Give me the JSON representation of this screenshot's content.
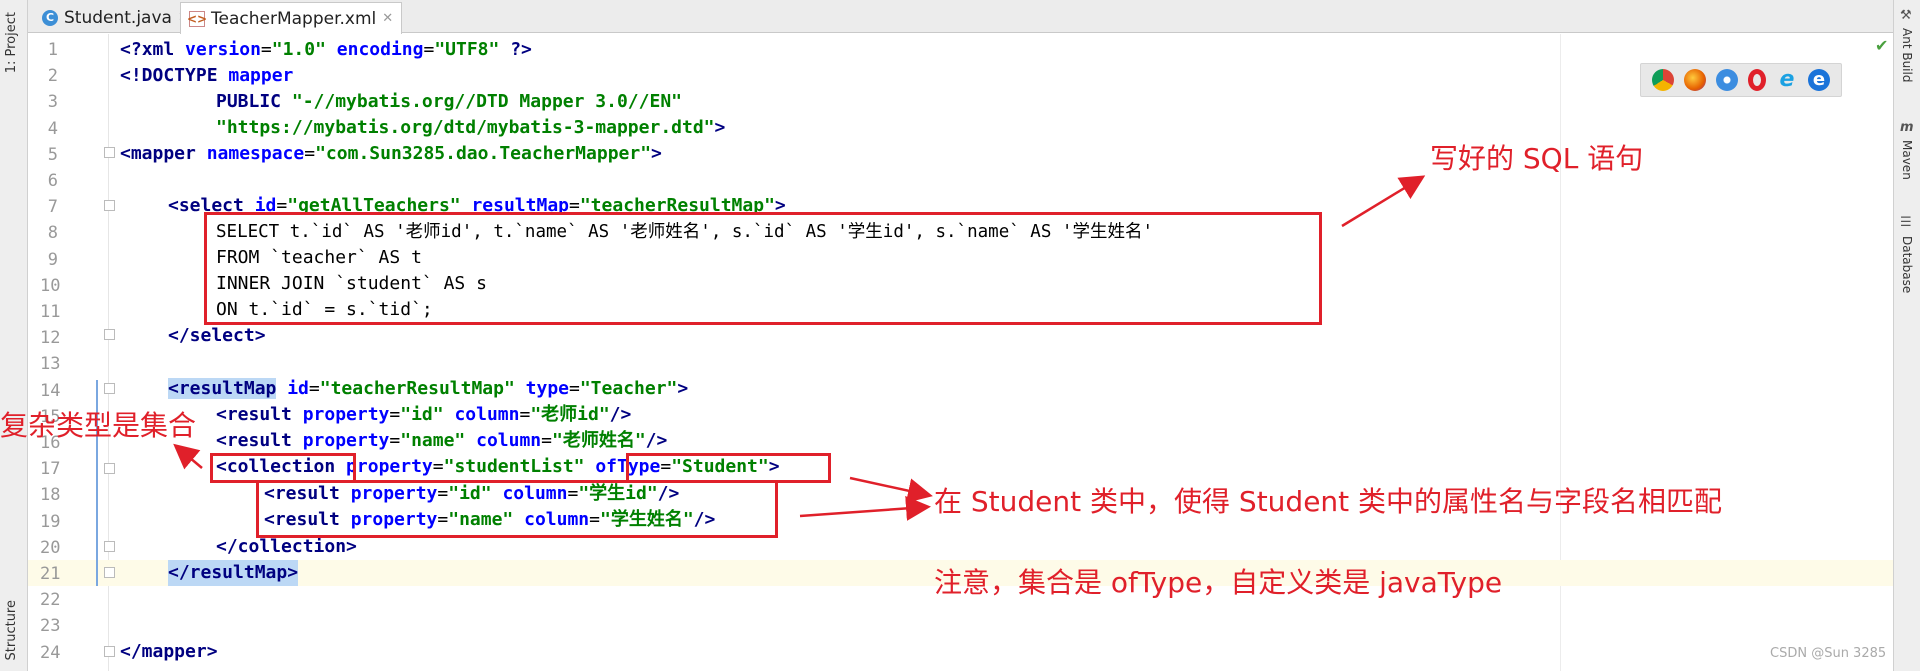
{
  "tabs": [
    {
      "label": "Student.java",
      "icon": "java-class-icon",
      "active": false
    },
    {
      "label": "TeacherMapper.xml",
      "icon": "xml-file-icon",
      "active": true
    }
  ],
  "left_tools": {
    "project": "1: Project",
    "structure": "Structure"
  },
  "right_tools": {
    "ant": "Ant Build",
    "maven": "Maven",
    "database": "Database"
  },
  "line_numbers": [
    "1",
    "2",
    "3",
    "4",
    "5",
    "6",
    "7",
    "8",
    "9",
    "10",
    "11",
    "12",
    "13",
    "14",
    "15",
    "16",
    "17",
    "18",
    "19",
    "20",
    "21",
    "22",
    "23",
    "24"
  ],
  "code": {
    "l1": {
      "a": "<?",
      "b": "xml ",
      "c": "version",
      "d": "=",
      "e": "\"1.0\"",
      "f": " encoding",
      "g": "=",
      "h": "\"UTF8\"",
      "i": " ?>"
    },
    "l2": {
      "a": "<!DOCTYPE ",
      "b": "mapper"
    },
    "l3": {
      "a": "PUBLIC ",
      "b": "\"-//mybatis.org//DTD Mapper 3.0//EN\""
    },
    "l4": {
      "a": "\"https://mybatis.org/dtd/mybatis-3-mapper.dtd\"",
      "b": ">"
    },
    "l5": {
      "a": "<mapper ",
      "b": "namespace",
      "c": "=",
      "d": "\"com.Sun3285.dao.TeacherMapper\"",
      "e": ">"
    },
    "l7": {
      "a": "<select ",
      "b": "id",
      "c": "=",
      "d": "\"getAllTeachers\"",
      "e": " resultMap",
      "f": "=",
      "g": "\"teacherResultMap\"",
      "h": ">"
    },
    "l8": "SELECT t.`id` AS '老师id', t.`name` AS '老师姓名', s.`id` AS '学生id', s.`name` AS '学生姓名'",
    "l9": "FROM `teacher` AS t",
    "l10": "INNER JOIN `student` AS s",
    "l11": "ON t.`id` = s.`tid`;",
    "l12": "</select>",
    "l14": {
      "a": "<resultMap",
      "b": " id",
      "c": "=",
      "d": "\"teacherResultMap\"",
      "e": " type",
      "f": "=",
      "g": "\"Teacher\"",
      "h": ">"
    },
    "l15": {
      "a": "<result ",
      "b": "property",
      "c": "=",
      "d": "\"id\"",
      "e": " column",
      "f": "=",
      "g": "\"老师id\"",
      "h": "/>"
    },
    "l16": {
      "a": "<result ",
      "b": "property",
      "c": "=",
      "d": "\"name\"",
      "e": " column",
      "f": "=",
      "g": "\"老师姓名\"",
      "h": "/>"
    },
    "l17": {
      "a": "<collection",
      "b": " property",
      "c": "=",
      "d": "\"studentList\"",
      "e": " ofType",
      "f": "=",
      "g": "\"Student\"",
      "h": ">"
    },
    "l18": {
      "a": "<result ",
      "b": "property",
      "c": "=",
      "d": "\"id\"",
      "e": " column",
      "f": "=",
      "g": "\"学生id\"",
      "h": "/>"
    },
    "l19": {
      "a": "<result ",
      "b": "property",
      "c": "=",
      "d": "\"name\"",
      "e": " column",
      "f": "=",
      "g": "\"学生姓名\"",
      "h": "/>"
    },
    "l20": "</collection>",
    "l21": "</resultMap>",
    "l24": "</mapper>"
  },
  "annotations": {
    "sql": "写好的 SQL 语句",
    "complex": "复杂类型是集合",
    "student_map": "在 Student 类中，使得 Student 类中的属性名与字段名相匹配",
    "note": "注意，集合是 ofType，自定义类是 javaType"
  },
  "browsers": [
    "chrome-icon",
    "firefox-icon",
    "safari-icon",
    "opera-icon",
    "ie-icon",
    "edge-icon"
  ],
  "colors": {
    "annotation_red": "#e0202a",
    "tag": "#000080",
    "attr": "#0000ff",
    "value": "#008000"
  },
  "watermark": "CSDN @Sun 3285"
}
